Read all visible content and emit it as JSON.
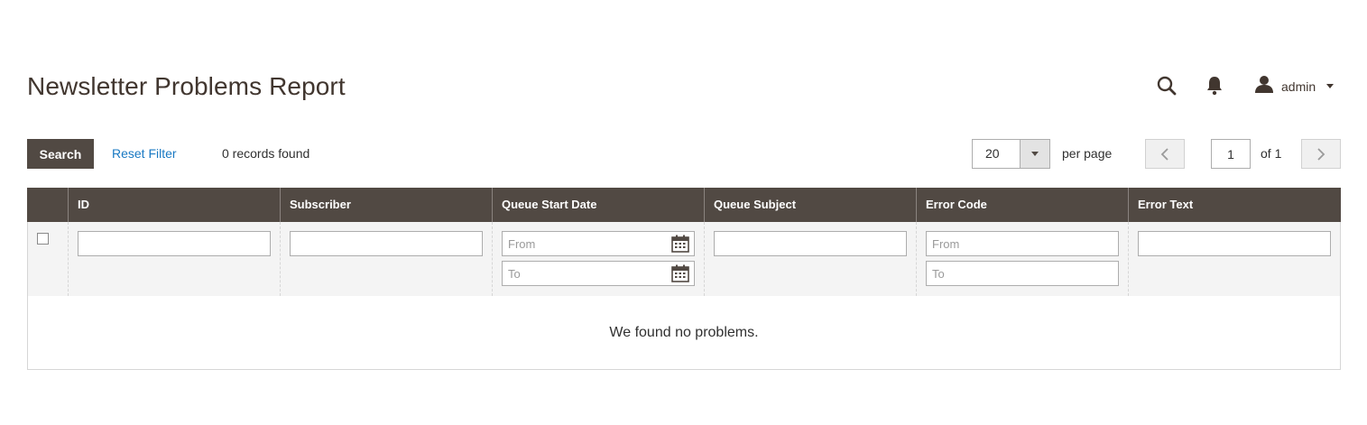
{
  "header": {
    "title": "Newsletter Problems Report",
    "user_name": "admin",
    "icons": [
      "search-icon",
      "bell-icon",
      "user-icon"
    ]
  },
  "toolbar": {
    "search_label": "Search",
    "reset_label": "Reset Filter",
    "records_text": "0 records found",
    "per_page_value": "20",
    "per_page_label": "per page",
    "current_page": "1",
    "page_of_text": "of 1"
  },
  "grid": {
    "columns": [
      "ID",
      "Subscriber",
      "Queue Start Date",
      "Queue Subject",
      "Error Code",
      "Error Text"
    ],
    "date_from_placeholder": "From",
    "date_to_placeholder": "To",
    "code_from_placeholder": "From",
    "code_to_placeholder": "To",
    "empty_text": "We found no problems."
  },
  "colors": {
    "header_bg": "#514943",
    "link": "#1979c3",
    "filter_bg": "#f4f4f4"
  }
}
